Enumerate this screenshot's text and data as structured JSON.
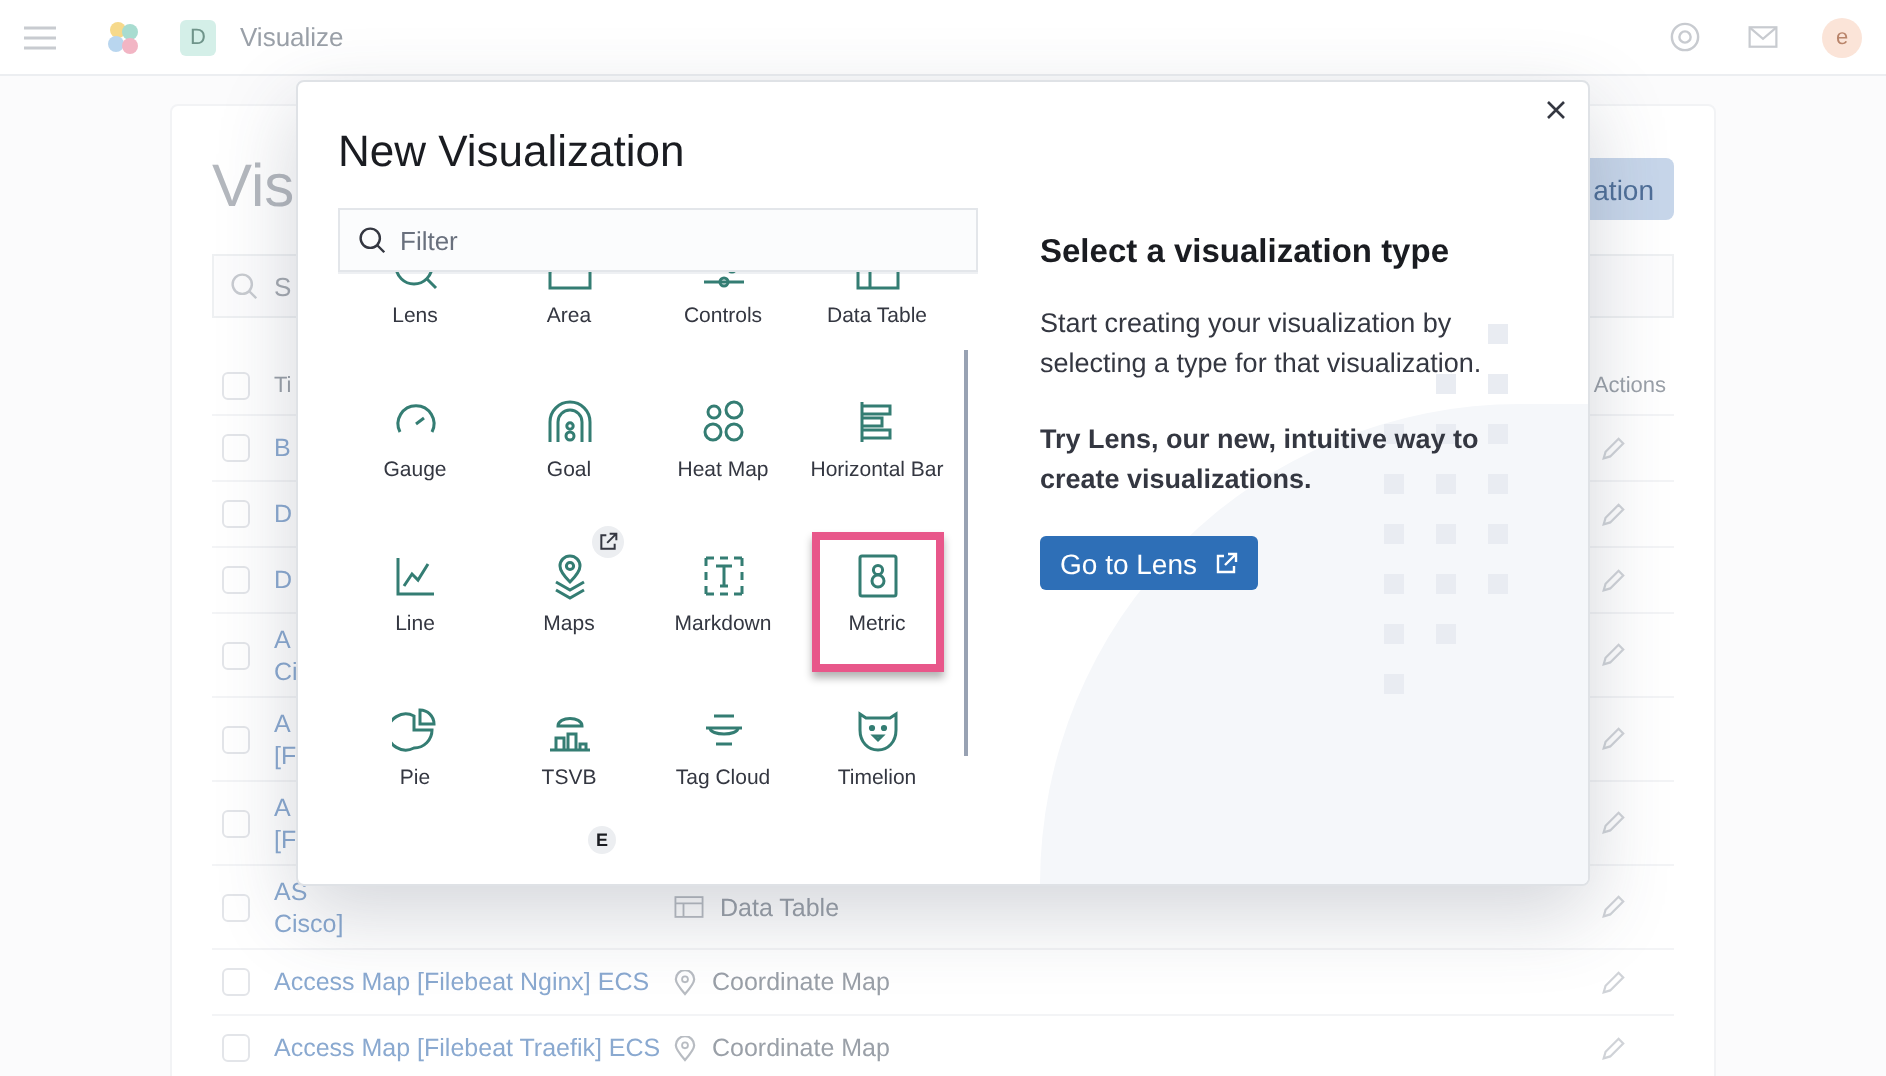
{
  "header": {
    "space_initial": "D",
    "breadcrumb": "Visualize",
    "user_initial": "e"
  },
  "page": {
    "title": "Vis",
    "search_placeholder": "S",
    "create_button": "ation",
    "columns": [
      "Ti",
      "Actions"
    ],
    "header_checked": false,
    "rows": [
      {
        "checked": false,
        "title": [
          "B"
        ]
      },
      {
        "checked": false,
        "title": [
          "D"
        ]
      },
      {
        "checked": false,
        "title": [
          "D"
        ]
      },
      {
        "checked": false,
        "title": [
          "A",
          "Ci"
        ]
      },
      {
        "checked": false,
        "title": [
          "A",
          "[F"
        ]
      },
      {
        "checked": false,
        "title": [
          "A",
          "[F"
        ]
      },
      {
        "checked": false,
        "title": [
          "AS",
          "Cisco]"
        ],
        "type": "Data Table",
        "kind": "table"
      },
      {
        "checked": false,
        "title": [
          "Access Map [Filebeat Nginx] ECS"
        ],
        "type": "Coordinate Map",
        "kind": "pin"
      },
      {
        "checked": false,
        "title": [
          "Access Map [Filebeat Traefik] ECS"
        ],
        "type": "Coordinate Map",
        "kind": "pin"
      }
    ]
  },
  "modal": {
    "title": "New Visualization",
    "filter_placeholder": "Filter",
    "types": [
      {
        "label": "Lens",
        "selected": false
      },
      {
        "label": "Area",
        "selected": false
      },
      {
        "label": "Controls",
        "selected": false
      },
      {
        "label": "Data Table",
        "selected": false
      },
      {
        "label": "Gauge",
        "selected": false
      },
      {
        "label": "Goal",
        "selected": false
      },
      {
        "label": "Heat Map",
        "selected": false
      },
      {
        "label": "Horizontal Bar",
        "selected": false
      },
      {
        "label": "Line",
        "selected": false
      },
      {
        "label": "Maps",
        "selected": false,
        "external": true
      },
      {
        "label": "Markdown",
        "selected": false
      },
      {
        "label": "Metric",
        "selected": true
      },
      {
        "label": "Pie",
        "selected": false
      },
      {
        "label": "TSVB",
        "selected": false
      },
      {
        "label": "Tag Cloud",
        "selected": false
      },
      {
        "label": "Timelion",
        "selected": false
      },
      {
        "badge": "E"
      }
    ],
    "heading": "Select a visualization type",
    "description": "Start creating your visualization by selecting a type for that visualization.",
    "promo": "Try Lens, our new, intuitive way to create visualizations.",
    "lens_button": "Go to Lens"
  }
}
